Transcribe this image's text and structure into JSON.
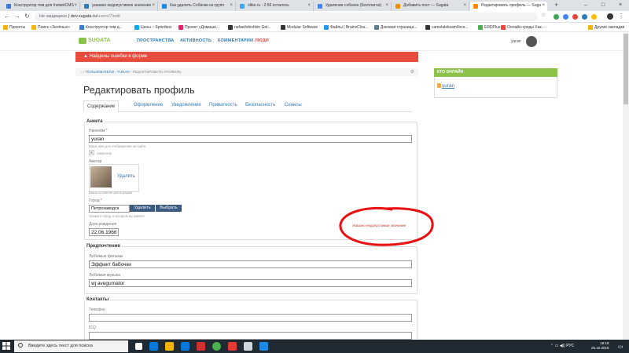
{
  "browser": {
    "tabs": [
      {
        "title": "Конструктор тем для InstantCMS",
        "color": "#3a7bd5"
      },
      {
        "title": "указано недопустимое значение",
        "color": "#2e7bb8"
      },
      {
        "title": "Как удалить Собачки из групп",
        "color": "#1e88e5"
      },
      {
        "title": "olike.ru - 2:56 осталось",
        "color": "#42a5f5"
      },
      {
        "title": "Удаление собачек (бесплатно)",
        "color": "#4285f4"
      },
      {
        "title": "Добавить пост — Sugata",
        "color": "#fb8c00"
      },
      {
        "title": "Редактировать профиль — Suga",
        "color": "#fb8c00"
      }
    ],
    "address": {
      "security": "Не защищено",
      "domain": "dev.sugata.ru",
      "path": "/users/7/edit"
    },
    "bookmarks": [
      {
        "label": "Проекты",
        "color": "#f4b400"
      },
      {
        "label": "Поиск «Зелёных»",
        "color": "#f4b400"
      },
      {
        "label": "Конструктор тем д...",
        "color": "#3a7bd5"
      },
      {
        "label": "Цены :: Sprintbox",
        "color": "#03a9f4"
      },
      {
        "label": "Проект «Домашн...",
        "color": "#e91e63"
      },
      {
        "label": "nafael/shishkin Get...",
        "color": "#333333"
      },
      {
        "label": "Modular Software",
        "color": "#333333"
      },
      {
        "label": "Файлы | BrainsClou...",
        "color": "#2196f3"
      },
      {
        "label": "Доковая страница...",
        "color": "#607d8b"
      },
      {
        "label": "camelaleksam/locs...",
        "color": "#333333"
      },
      {
        "label": "ERDPlus",
        "color": "#4caf50"
      },
      {
        "label": "Онлайн-среды Хак...",
        "color": "#f44336"
      },
      {
        "label": "Другие закладки",
        "color": "#f4b400"
      }
    ]
  },
  "site": {
    "logo": "SUGATA",
    "nav": [
      "ПРОСТРАНСТВА",
      "АКТИВНОСТЬ",
      "КОММЕНТАРИИ",
      "ЛЮДИ"
    ],
    "user": "yuran",
    "error_banner": "Найдены ошибки в форме",
    "breadcrumb": [
      "ПОЛЬЗОВАТЕЛИ",
      "YURAN",
      "РЕДАКТИРОВАТЬ ПРОФИЛЬ"
    ],
    "page_title": "Редактировать профиль",
    "tabs": [
      "Содержание",
      "Оформление",
      "Уведомления",
      "Приватность",
      "Безопасность",
      "Сеансы"
    ],
    "form": {
      "anketa_legend": "Анкета",
      "nickname_label": "Никнейм",
      "nickname_value": "yuran",
      "nickname_hint": "Ваше имя для отображения на сайте",
      "karma_value": "5",
      "karma_label": "символов",
      "avatar_label": "Аватар",
      "avatar_delete": "Удалить",
      "avatar_hint": "Ваша основная фотография",
      "city_label": "Город",
      "city_value": "Петрозаводск",
      "city_delete": "Удалить",
      "city_choose": "Выбрать",
      "city_hint": "Укажите город, в котором вы живете",
      "birth_label": "Дата рождения",
      "birth_value": "22.06.1966",
      "error_message": "Указано недопустимое значение",
      "prefs_legend": "Предпочтения",
      "films_label": "Любимые фильмы",
      "films_value": "Эффект бабочки",
      "music_label": "Любимая музыка",
      "music_value": "wj avegumator",
      "contacts_legend": "Контакты",
      "phone_label": "Телефон",
      "phone_value": "",
      "icq_label": "ICQ",
      "icq_value": ""
    },
    "online": {
      "title": "КТО ОНЛАЙН",
      "user": "yuran"
    }
  },
  "taskbar": {
    "search_placeholder": "Введите здесь текст для поиска",
    "lang": "РУС",
    "time": "18:18",
    "date": "25.10.2018"
  }
}
